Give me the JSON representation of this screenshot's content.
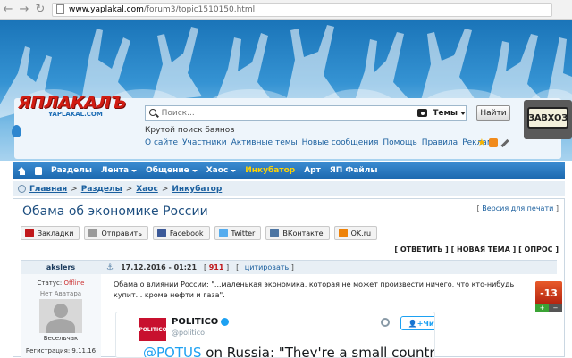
{
  "browser": {
    "url_host": "www.yaplakal.com",
    "url_path": "/forum3/topic1510150.html"
  },
  "header": {
    "logo_text": "ЯПЛАКАЛЪ",
    "logo_sub": "YAPLAKAL.COM",
    "search_placeholder": "Поиск...",
    "search_scope": "Темы",
    "find_button": "Найти",
    "tagline": "Крутой поиск баянов",
    "top_links": [
      "О сайте",
      "Участники",
      "Активные темы",
      "Новые сообщения",
      "Помощь",
      "Правила",
      "Реклама"
    ],
    "plate_text": "ЗАВХОЗ"
  },
  "menu": {
    "items": [
      {
        "label": "Разделы",
        "dropdown": false,
        "highlight": false
      },
      {
        "label": "Лента",
        "dropdown": true,
        "highlight": false
      },
      {
        "label": "Общение",
        "dropdown": true,
        "highlight": false
      },
      {
        "label": "Хаос",
        "dropdown": true,
        "highlight": false
      },
      {
        "label": "Инкубатор",
        "dropdown": false,
        "highlight": true
      },
      {
        "label": "Арт",
        "dropdown": false,
        "highlight": false
      },
      {
        "label": "ЯП Файлы",
        "dropdown": false,
        "highlight": false
      }
    ]
  },
  "breadcrumb": [
    "Главная",
    "Разделы",
    "Хаос",
    "Инкубатор"
  ],
  "topic": {
    "title": "Обама об экономике России",
    "print_link": "Версия для печати",
    "share_buttons": [
      {
        "label": "Закладки",
        "color": "#222222"
      },
      {
        "label": "Отправить",
        "color": "#7a7a7a"
      },
      {
        "label": "Facebook",
        "color": "#3b5998"
      },
      {
        "label": "Twitter",
        "color": "#55acee"
      },
      {
        "label": "ВКонтакте",
        "color": "#4c75a3"
      },
      {
        "label": "OK.ru",
        "color": "#ee8208"
      }
    ],
    "actions": [
      "ОТВЕТИТЬ",
      "НОВАЯ ТЕМА",
      "ОПРОС"
    ]
  },
  "post": {
    "author": "akslers",
    "date": "17.12.2016 - 01:21",
    "number": "911",
    "quote": "цитировать",
    "status_label": "Статус:",
    "status_value": "Offline",
    "no_avatar": "Нет Аватара",
    "rank": "Весельчак",
    "registration": "Регистрация: 9.11.16",
    "text": "Обама о влиянии России: \"...маленькая экономика, которая не может произвести ничего, что кто-нибудь купит... кроме нефти и газа\".",
    "rating": "-13",
    "rate_plus": "+",
    "rate_minus": "−"
  },
  "tweet": {
    "avatar_text": "POLITICO",
    "name": "POLITICO",
    "handle": "@politico",
    "follow_label": "Читать",
    "mention": "@POTUS",
    "text_rest": " on Russia: \"They're a small country..."
  }
}
